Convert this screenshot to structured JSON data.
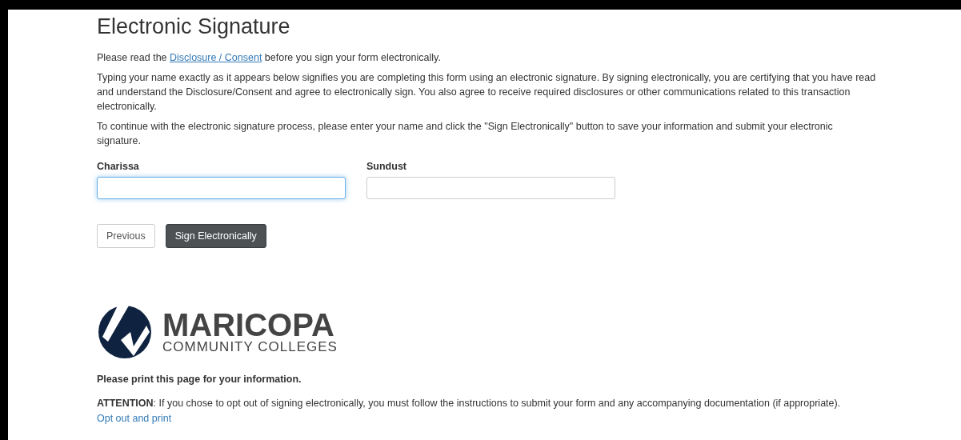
{
  "heading": "Electronic Signature",
  "intro": {
    "before": "Please read the ",
    "link": "Disclosure / Consent",
    "after": " before you sign your form electronically."
  },
  "paragraphs": [
    "Typing your name exactly as it appears below signifies you are completing this form using an electronic signature. By signing electronically, you are certifying that you have read and understand the Disclosure/Consent and agree to electronically sign. You also agree to receive required disclosures or other communications related to this transaction electronically.",
    "To continue with the electronic signature process, please enter your name and click the \"Sign Electronically\" button to save your information and submit your electronic signature."
  ],
  "fields": [
    {
      "label": "Charissa",
      "focused": true
    },
    {
      "label": "Sundust",
      "focused": false
    }
  ],
  "buttons": [
    {
      "label": "Previous",
      "kind": "secondary"
    },
    {
      "label": "Sign Electronically",
      "kind": "primary"
    }
  ],
  "logo": {
    "name": "MARICOPA",
    "subtitle": "COMMUNITY COLLEGES"
  },
  "print_note": "Please print this page for your information.",
  "attention": "**ATTENTION**: If you chose to opt out of signing electronically, you must follow the instructions to submit your form and any accompanying documentation (if appropriate).",
  "opt_out_link": "Opt out and print"
}
